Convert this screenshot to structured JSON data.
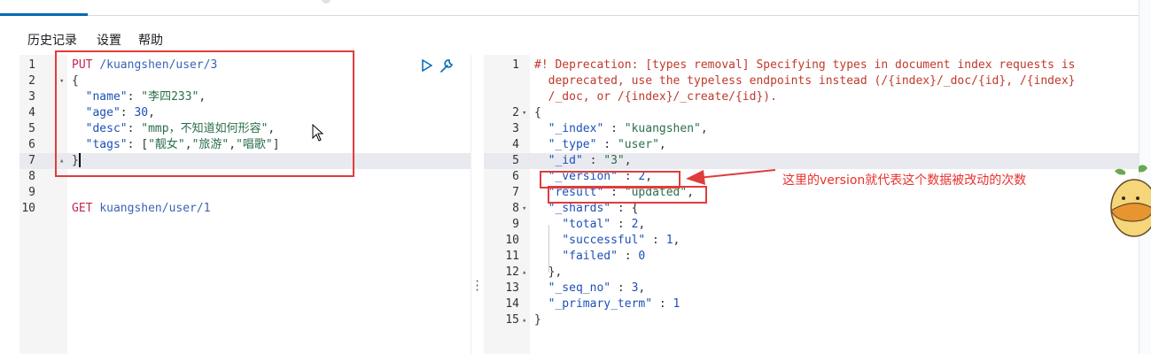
{
  "menu": {
    "history": "历史记录",
    "settings": "设置",
    "help": "帮助"
  },
  "request_editor": {
    "lines": [
      {
        "n": "1",
        "tokens": [
          [
            "c-method",
            "PUT"
          ],
          [
            "c-punc",
            " "
          ],
          [
            "c-url",
            "/kuangshen/user/3"
          ]
        ]
      },
      {
        "n": "2",
        "fold": "▾",
        "tokens": [
          [
            "c-punc",
            "{"
          ]
        ]
      },
      {
        "n": "3",
        "tokens": [
          [
            "c-punc",
            "  "
          ],
          [
            "c-key",
            "\"name\""
          ],
          [
            "c-punc",
            ": "
          ],
          [
            "c-str",
            "\"李四233\""
          ],
          [
            "c-punc",
            ","
          ]
        ]
      },
      {
        "n": "4",
        "tokens": [
          [
            "c-punc",
            "  "
          ],
          [
            "c-key",
            "\"age\""
          ],
          [
            "c-punc",
            ": "
          ],
          [
            "c-num",
            "30"
          ],
          [
            "c-punc",
            ","
          ]
        ]
      },
      {
        "n": "5",
        "tokens": [
          [
            "c-punc",
            "  "
          ],
          [
            "c-key",
            "\"desc\""
          ],
          [
            "c-punc",
            ": "
          ],
          [
            "c-str",
            "\"mmp，不知道如何形容\""
          ],
          [
            "c-punc",
            ","
          ]
        ]
      },
      {
        "n": "6",
        "tokens": [
          [
            "c-punc",
            "  "
          ],
          [
            "c-key",
            "\"tags\""
          ],
          [
            "c-punc",
            ": ["
          ],
          [
            "c-str",
            "\"靓女\""
          ],
          [
            "c-punc",
            ","
          ],
          [
            "c-str",
            "\"旅游\""
          ],
          [
            "c-punc",
            ","
          ],
          [
            "c-str",
            "\"唱歌\""
          ],
          [
            "c-punc",
            "]"
          ]
        ]
      },
      {
        "n": "7",
        "fold": "▴",
        "tokens": [
          [
            "c-punc",
            "}"
          ]
        ]
      },
      {
        "n": "8",
        "tokens": []
      },
      {
        "n": "9",
        "tokens": []
      },
      {
        "n": "10",
        "tokens": [
          [
            "c-method",
            "GET"
          ],
          [
            "c-punc",
            " "
          ],
          [
            "c-url",
            "kuangshen/user/1"
          ]
        ]
      }
    ]
  },
  "response_viewer": {
    "lines": [
      {
        "n": "1",
        "tokens": [
          [
            "c-warn",
            "#! Deprecation: [types removal] Specifying types in document index requests is"
          ]
        ]
      },
      {
        "n": "",
        "tokens": [
          [
            "c-warn",
            "  deprecated, use the typeless endpoints instead (/{index}/_doc/{id}, /{index}"
          ]
        ]
      },
      {
        "n": "",
        "tokens": [
          [
            "c-warn",
            "  /_doc, or /{index}/_create/{id})."
          ]
        ]
      },
      {
        "n": "2",
        "fold": "▾",
        "tokens": [
          [
            "c-punc",
            "{"
          ]
        ]
      },
      {
        "n": "3",
        "tokens": [
          [
            "c-punc",
            "  "
          ],
          [
            "c-key",
            "\"_index\""
          ],
          [
            "c-punc",
            " : "
          ],
          [
            "c-str",
            "\"kuangshen\""
          ],
          [
            "c-punc",
            ","
          ]
        ]
      },
      {
        "n": "4",
        "tokens": [
          [
            "c-punc",
            "  "
          ],
          [
            "c-key",
            "\"_type\""
          ],
          [
            "c-punc",
            " : "
          ],
          [
            "c-str",
            "\"user\""
          ],
          [
            "c-punc",
            ","
          ]
        ]
      },
      {
        "n": "5",
        "tokens": [
          [
            "c-punc",
            "  "
          ],
          [
            "c-key",
            "\"_id\""
          ],
          [
            "c-punc",
            " : "
          ],
          [
            "c-str",
            "\"3\""
          ],
          [
            "c-punc",
            ","
          ]
        ]
      },
      {
        "n": "6",
        "tokens": [
          [
            "c-punc",
            "  "
          ],
          [
            "c-key",
            "\"_version\""
          ],
          [
            "c-punc",
            " : "
          ],
          [
            "c-num",
            "2"
          ],
          [
            "c-punc",
            ","
          ]
        ]
      },
      {
        "n": "7",
        "tokens": [
          [
            "c-punc",
            "  "
          ],
          [
            "c-key",
            "\"result\""
          ],
          [
            "c-punc",
            " : "
          ],
          [
            "c-str",
            "\"updated\""
          ],
          [
            "c-punc",
            ","
          ]
        ]
      },
      {
        "n": "8",
        "fold": "▾",
        "tokens": [
          [
            "c-punc",
            "  "
          ],
          [
            "c-key",
            "\"_shards\""
          ],
          [
            "c-punc",
            " : {"
          ]
        ]
      },
      {
        "n": "9",
        "tokens": [
          [
            "c-punc",
            "    "
          ],
          [
            "c-key",
            "\"total\""
          ],
          [
            "c-punc",
            " : "
          ],
          [
            "c-num",
            "2"
          ],
          [
            "c-punc",
            ","
          ]
        ]
      },
      {
        "n": "10",
        "tokens": [
          [
            "c-punc",
            "    "
          ],
          [
            "c-key",
            "\"successful\""
          ],
          [
            "c-punc",
            " : "
          ],
          [
            "c-num",
            "1"
          ],
          [
            "c-punc",
            ","
          ]
        ]
      },
      {
        "n": "11",
        "tokens": [
          [
            "c-punc",
            "    "
          ],
          [
            "c-key",
            "\"failed\""
          ],
          [
            "c-punc",
            " : "
          ],
          [
            "c-num",
            "0"
          ]
        ]
      },
      {
        "n": "12",
        "fold": "▴",
        "tokens": [
          [
            "c-punc",
            "  },"
          ]
        ]
      },
      {
        "n": "13",
        "tokens": [
          [
            "c-punc",
            "  "
          ],
          [
            "c-key",
            "\"_seq_no\""
          ],
          [
            "c-punc",
            " : "
          ],
          [
            "c-num",
            "3"
          ],
          [
            "c-punc",
            ","
          ]
        ]
      },
      {
        "n": "14",
        "tokens": [
          [
            "c-punc",
            "  "
          ],
          [
            "c-key",
            "\"_primary_term\""
          ],
          [
            "c-punc",
            " : "
          ],
          [
            "c-num",
            "1"
          ]
        ]
      },
      {
        "n": "15",
        "fold": "▴",
        "tokens": [
          [
            "c-punc",
            "}"
          ]
        ]
      }
    ]
  },
  "annotation": {
    "text": "这里的version就代表这个数据被改动的次数"
  },
  "icons": {
    "run": "play-icon",
    "settings": "wrench-icon"
  },
  "colors": {
    "annotation_red": "#e03c3c",
    "tab_accent": "#006bb4"
  }
}
